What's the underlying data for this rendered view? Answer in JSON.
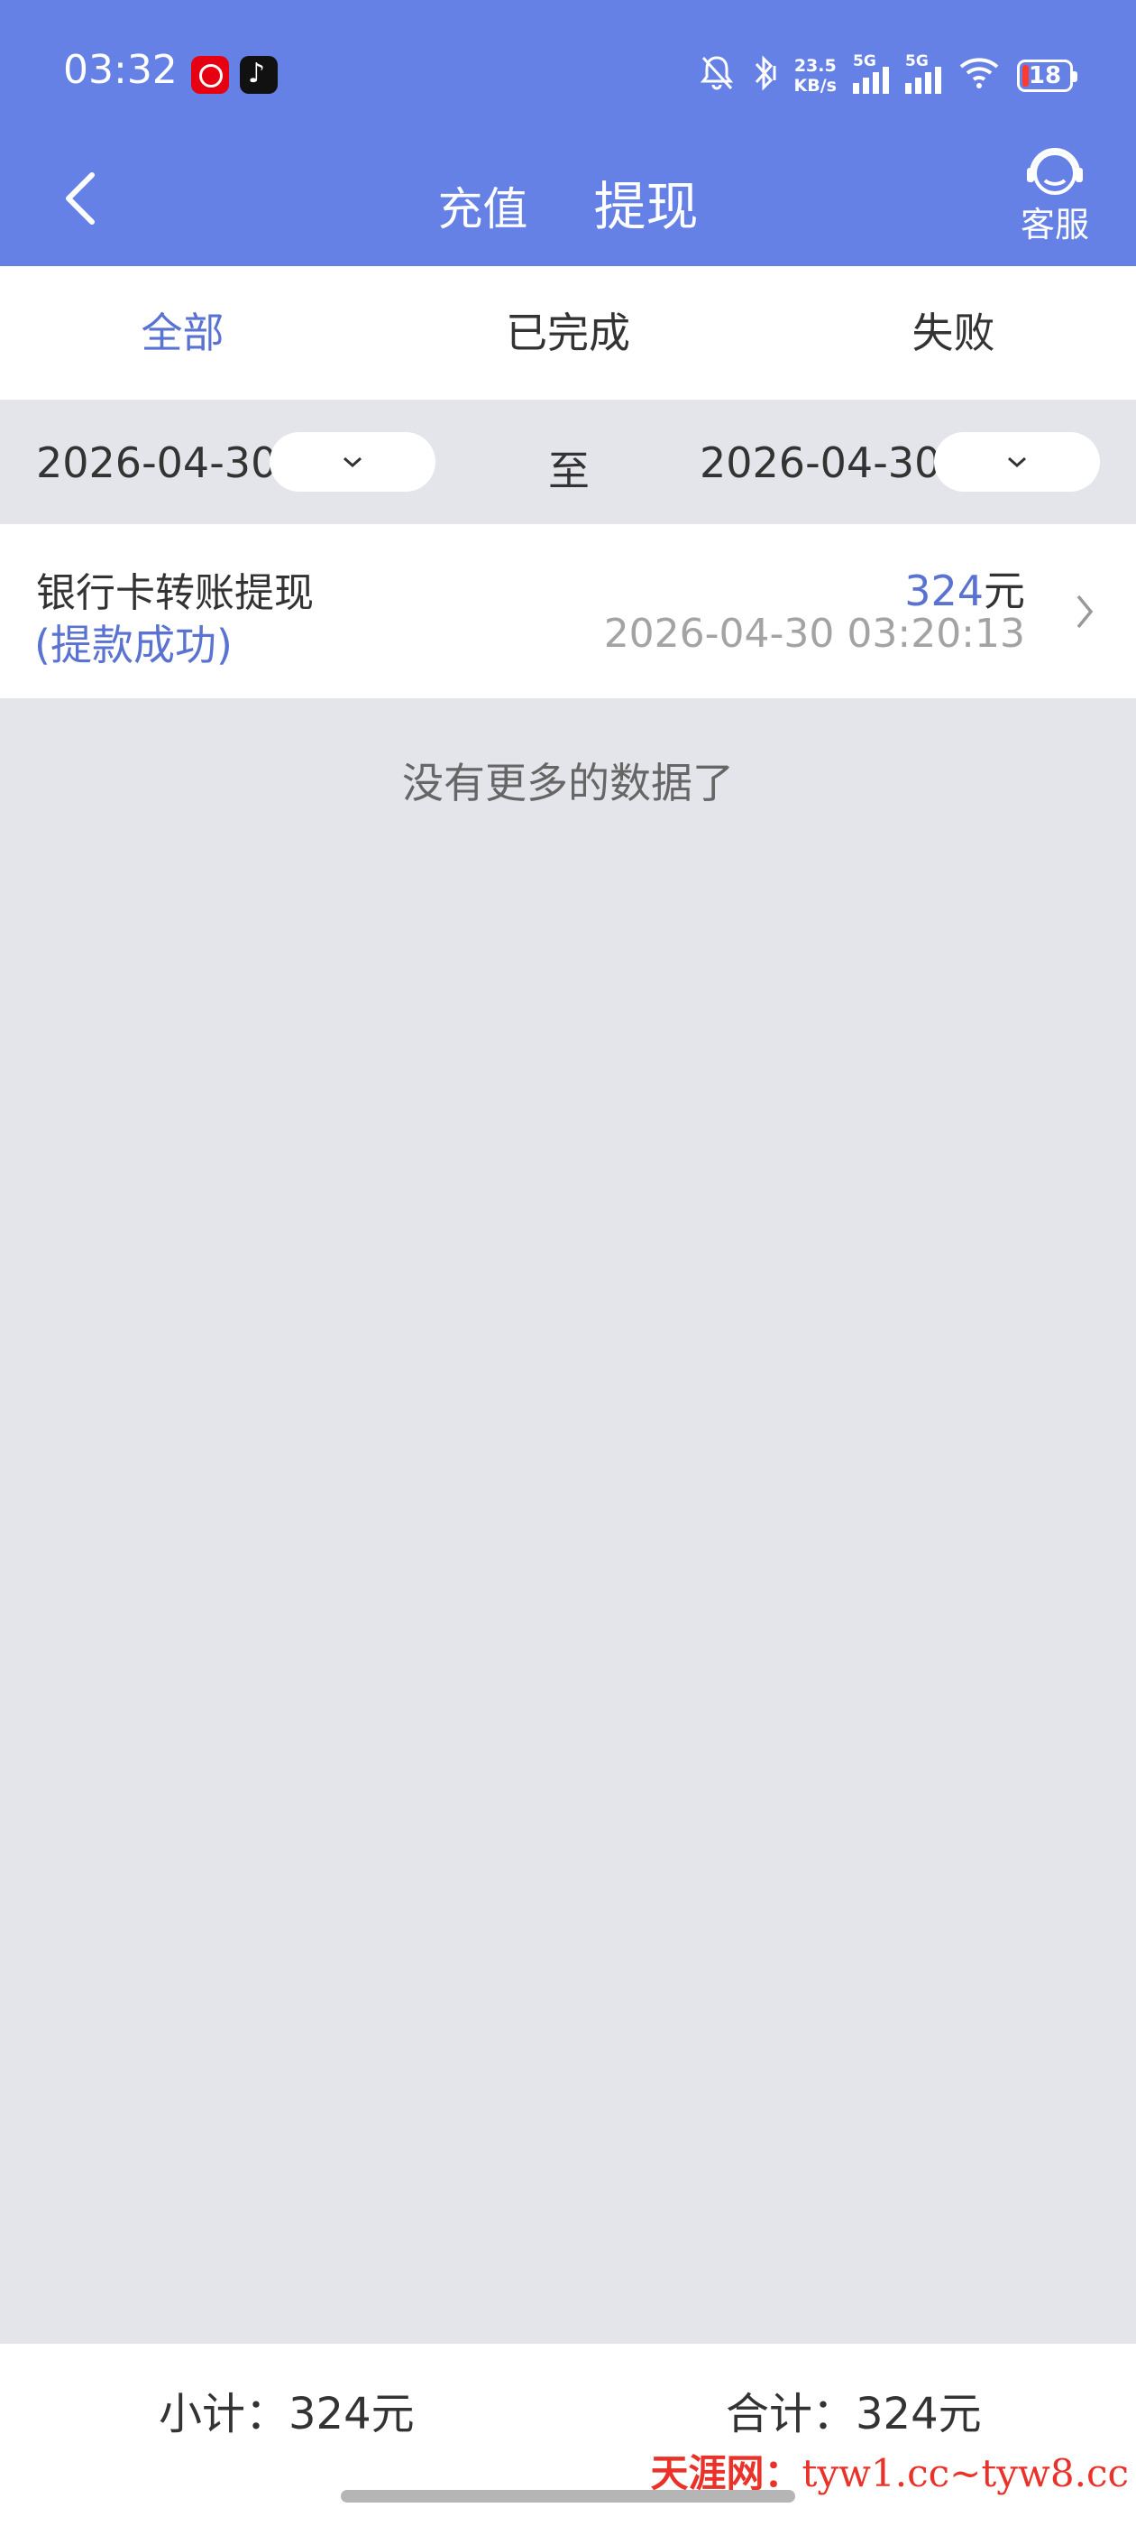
{
  "status_bar": {
    "time": "03:32",
    "net_speed_value": "23.5",
    "net_speed_unit": "KB/s",
    "sim1": "5G",
    "sim2": "5G",
    "battery": "18",
    "icons": [
      "netease-music-icon",
      "tiktok-icon",
      "mute-bell-icon",
      "bluetooth-icon",
      "signal-icon",
      "wifi-icon",
      "battery-icon"
    ]
  },
  "header": {
    "tabs": [
      "充值",
      "提现"
    ],
    "active_tab": "提现",
    "service_label": "客服",
    "background_color": "#6581e5"
  },
  "filter_tabs": {
    "items": [
      "全部",
      "已完成",
      "失败"
    ],
    "active": "全部",
    "active_color": "#5a72d2"
  },
  "date_range": {
    "start": "2026-04-30",
    "separator": "至",
    "end": "2026-04-30"
  },
  "records": [
    {
      "title": "银行卡转账提现",
      "status": "(提款成功)",
      "amount": "324",
      "currency": "元",
      "time": "2026-04-30 03:20:13"
    }
  ],
  "list_end_text": "没有更多的数据了",
  "footer": {
    "subtotal": "小计：324元",
    "total": "合计：324元"
  },
  "watermark": {
    "brand": "天涯网：",
    "sites": "tyw1.cc~tyw8.cc"
  }
}
